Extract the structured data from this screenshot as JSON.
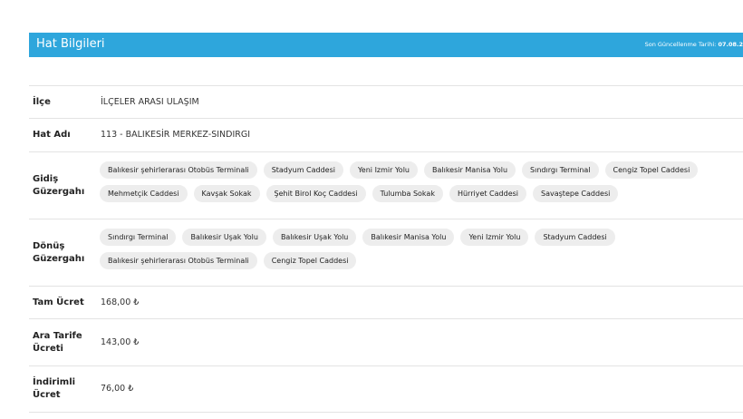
{
  "header": {
    "title": "Hat Bilgileri",
    "date_label": "Son Güncellenme Tarihi:",
    "date_value": "07.08.2"
  },
  "rows": {
    "ilce": {
      "label": "İlçe",
      "value": "İLÇELER ARASI ULAŞIM"
    },
    "hat_adi": {
      "label": "Hat Adı",
      "value": "113 - BALIKESİR MERKEZ-SINDIRGI"
    },
    "gidis": {
      "label": "Gidiş Güzergahı",
      "stops": [
        "Balıkesir şehirlerarası Otobüs Terminali",
        "Stadyum Caddesi",
        "Yeni Izmir Yolu",
        "Balıkesir Manisa Yolu",
        "Sındırgı Terminal",
        "Cengiz Topel Caddesi",
        "Mehmetçik Caddesi",
        "Kavşak Sokak",
        "Şehit Birol Koç Caddesi",
        "Tulumba Sokak",
        "Hürriyet Caddesi",
        "Savaştepe Caddesi"
      ]
    },
    "donus": {
      "label": "Dönüş Güzergahı",
      "stops": [
        "Sındırgı Terminal",
        "Balıkesir Uşak Yolu",
        "Balıkesir Uşak Yolu",
        "Balıkesir Manisa Yolu",
        "Yeni Izmir Yolu",
        "Stadyum Caddesi",
        "Balıkesir şehirlerarası Otobüs Terminali",
        "Cengiz Topel Caddesi"
      ]
    },
    "tam_ucret": {
      "label": "Tam Ücret",
      "value": "168,00 ₺"
    },
    "ara_tarife": {
      "label": "Ara Tarife Ücreti",
      "value": "143,00 ₺"
    },
    "indirimli": {
      "label": "İndirimli Ücret",
      "value": "76,00 ₺"
    }
  }
}
